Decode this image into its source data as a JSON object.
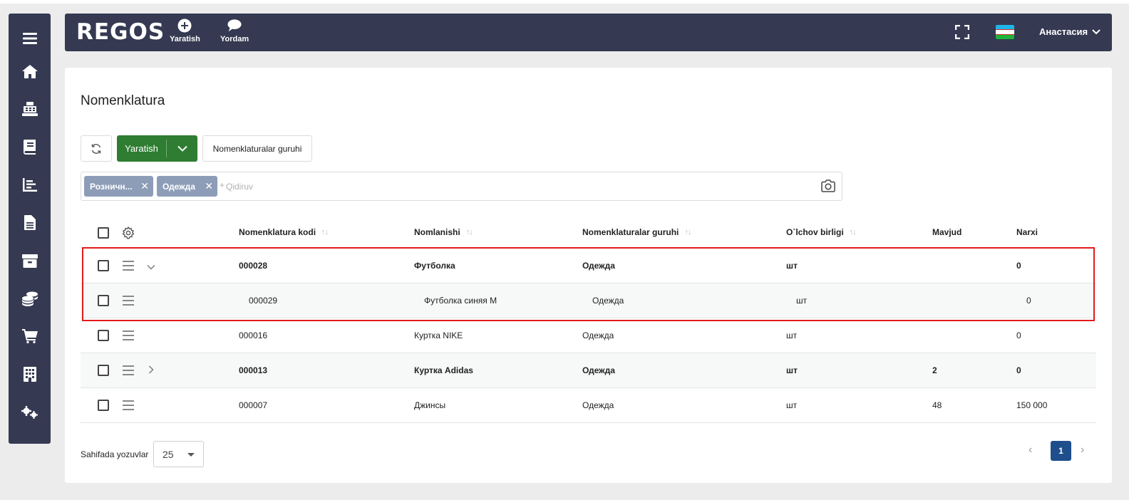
{
  "colors": {
    "sidebar_bg": "#353a52",
    "header_bg": "#353a52",
    "primary_green": "#2e7d32",
    "chip_bg": "#8d9db8",
    "highlight": "#e31b1b",
    "page_active": "#1f4e8c"
  },
  "sidebar": {
    "items": [
      {
        "icon": "menu-icon"
      },
      {
        "icon": "home-icon"
      },
      {
        "icon": "cash-register-icon"
      },
      {
        "icon": "book-icon"
      },
      {
        "icon": "reports-chart-icon"
      },
      {
        "icon": "document-icon"
      },
      {
        "icon": "warehouse-box-icon"
      },
      {
        "icon": "coins-icon"
      },
      {
        "icon": "shopping-cart-icon"
      },
      {
        "icon": "building-icon"
      },
      {
        "icon": "settings-gears-icon"
      }
    ]
  },
  "header": {
    "logo": "REGOS",
    "create_label": "Yaratish",
    "help_label": "Yordam",
    "user_name": "Анастасия"
  },
  "page": {
    "title": "Nomenklatura",
    "create_button": "Yaratish",
    "groups_button": "Nomenklaturalar guruhi"
  },
  "filters": {
    "chips": [
      "Розничн...",
      "Одежда"
    ],
    "search_placeholder": "Qidiruv",
    "plus": "+"
  },
  "table": {
    "columns": {
      "code": "Nomenklatura kodi",
      "name": "Nomlanishi",
      "group": "Nomenklaturalar guruhi",
      "unit": "O`lchov birligi",
      "stock": "Mavjud",
      "price": "Narxi"
    },
    "sort_glyph": "↑↓",
    "rows": [
      {
        "code": "000028",
        "name": "Футболка",
        "group": "Одежда",
        "unit": "шт",
        "stock": "",
        "price": "0"
      },
      {
        "code": "000029",
        "name": "Футболка синяя M",
        "group": "Одежда",
        "unit": "шт",
        "stock": "",
        "price": "0"
      },
      {
        "code": "000016",
        "name": "Куртка NIKE",
        "group": "Одежда",
        "unit": "шт",
        "stock": "",
        "price": "0"
      },
      {
        "code": "000013",
        "name": "Куртка Adidas",
        "group": "Одежда",
        "unit": "шт",
        "stock": "2",
        "price": "0"
      },
      {
        "code": "000007",
        "name": "Джинсы",
        "group": "Одежда",
        "unit": "шт",
        "stock": "48",
        "price": "150 000"
      }
    ]
  },
  "footer": {
    "rows_label": "Sahifada yozuvlar",
    "rows_value": "25",
    "current_page": "1",
    "prev": "‹",
    "next": "›"
  }
}
